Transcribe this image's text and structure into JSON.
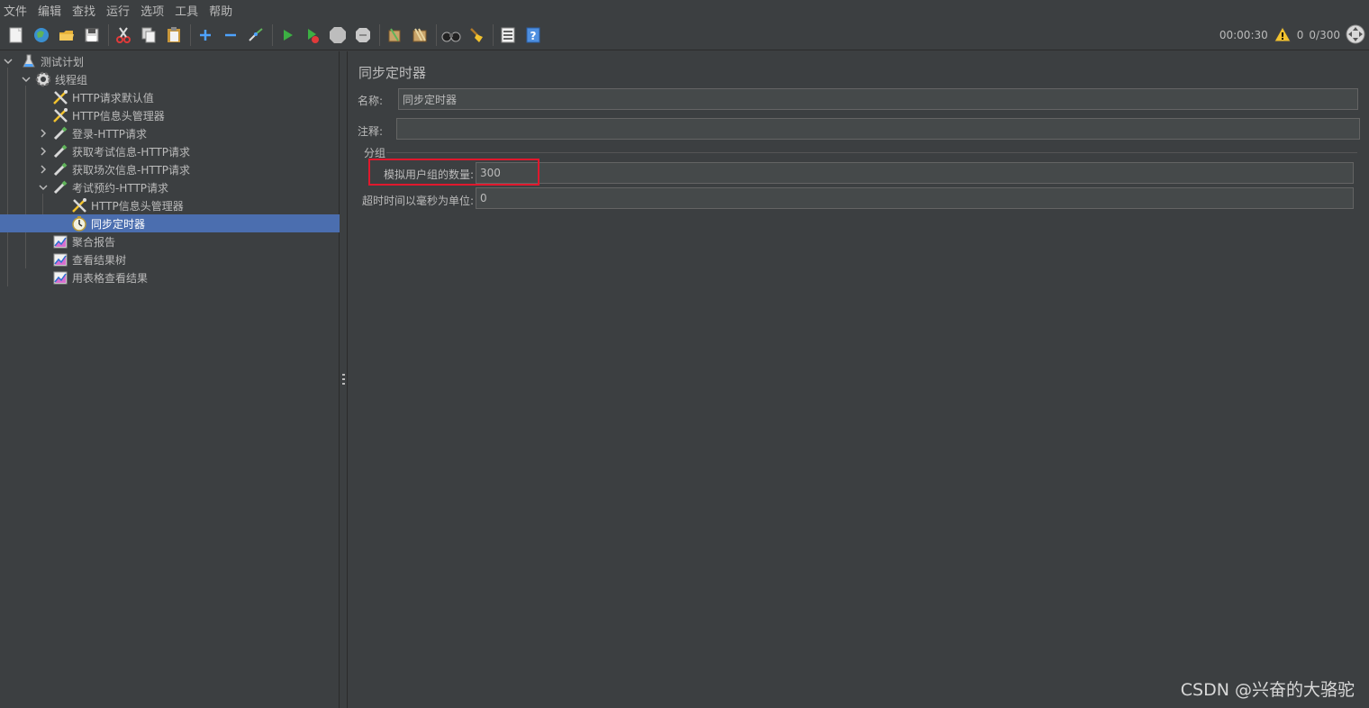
{
  "menu": [
    "文件",
    "编辑",
    "查找",
    "运行",
    "选项",
    "工具",
    "帮助"
  ],
  "toolbar": {
    "elapsed_time": "00:00:30",
    "warning_count": "0",
    "thread_count": "0/300"
  },
  "tree": {
    "items": [
      {
        "label": "测试计划",
        "icon": "test-plan-icon"
      },
      {
        "label": "线程组",
        "icon": "thread-group-gear-icon"
      },
      {
        "label": "HTTP请求默认值",
        "icon": "config-wrench-icon"
      },
      {
        "label": "HTTP信息头管理器",
        "icon": "config-wrench-icon"
      },
      {
        "label": "登录-HTTP请求",
        "icon": "sampler-pipette-icon"
      },
      {
        "label": "获取考试信息-HTTP请求",
        "icon": "sampler-pipette-icon"
      },
      {
        "label": "获取场次信息-HTTP请求",
        "icon": "sampler-pipette-icon"
      },
      {
        "label": "考试预约-HTTP请求",
        "icon": "sampler-pipette-icon"
      },
      {
        "label": "HTTP信息头管理器",
        "icon": "config-wrench-icon"
      },
      {
        "label": "同步定时器",
        "icon": "timer-icon"
      },
      {
        "label": "聚合报告",
        "icon": "listener-graph-icon"
      },
      {
        "label": "查看结果树",
        "icon": "listener-graph-icon"
      },
      {
        "label": "用表格查看结果",
        "icon": "listener-graph-icon"
      }
    ]
  },
  "form": {
    "title": "同步定时器",
    "name_label": "名称:",
    "name_value": "同步定时器",
    "comment_label": "注释:",
    "comment_value": "",
    "group_title": "分组",
    "users_label": "模拟用户组的数量:",
    "users_value": "300",
    "timeout_label": "超时时间以毫秒为单位:",
    "timeout_value": "0"
  },
  "colors": {
    "background": "#3c3f41",
    "selection": "#4b6eaf",
    "highlight_box": "#e0182d"
  },
  "watermark": "CSDN @兴奋的大骆驼"
}
